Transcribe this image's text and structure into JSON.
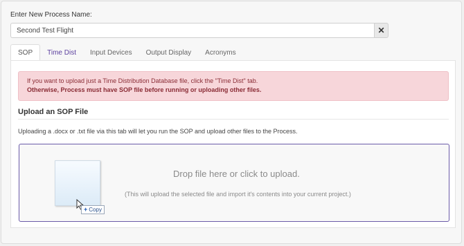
{
  "process": {
    "name_label": "Enter New Process Name:",
    "name_value": "Second Test Flight",
    "clear_label": "✕"
  },
  "tabs": [
    {
      "label": "SOP",
      "active": true
    },
    {
      "label": "Time Dist",
      "active": false
    },
    {
      "label": "Input Devices",
      "active": false
    },
    {
      "label": "Output Display",
      "active": false
    },
    {
      "label": "Acronyms",
      "active": false
    }
  ],
  "alert": {
    "line1": "If you want to upload just a Time Distribution Database file, click the \"Time Dist\" tab.",
    "line2": "Otherwise, Process must have SOP file before running or uploading other files."
  },
  "upload": {
    "title": "Upload an SOP File",
    "description": "Uploading a .docx or .txt file via this tab will let you run the SOP and upload other files to the Process.",
    "drop_title": "Drop file here or click to upload.",
    "drop_subtitle": "(This will upload the selected file and import it's contents into your current project.)",
    "copy_label": "Copy"
  },
  "colors": {
    "tab_link": "#5b3f9e",
    "alert_bg": "#f7d6da",
    "alert_text": "#8a2c35",
    "dropzone_border": "#6a5aa8"
  }
}
